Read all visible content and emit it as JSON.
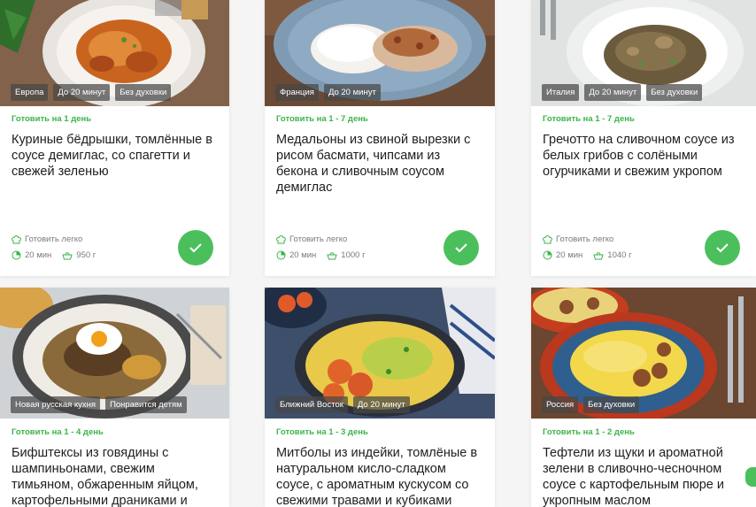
{
  "cards": [
    {
      "tags": [
        "Европа",
        "До 20 минут",
        "Без духовки"
      ],
      "cook_window": "Готовить на 1 день",
      "title": "Куриные бёдрышки, томлённые в соусе демиглас, со спагетти и свежей зеленью",
      "difficulty": "Готовить легко",
      "time": "20 мин",
      "weight": "950 г",
      "selected": true
    },
    {
      "tags": [
        "Франция",
        "До 20 минут"
      ],
      "cook_window": "Готовить на 1 - 7 день",
      "title": "Медальоны из свиной вырезки с рисом басмати, чипсами из бекона и сливочным соусом демиглас",
      "difficulty": "Готовить легко",
      "time": "20 мин",
      "weight": "1000 г",
      "selected": true
    },
    {
      "tags": [
        "Италия",
        "До 20 минут",
        "Без духовки"
      ],
      "cook_window": "Готовить на 1 - 7 день",
      "title": "Гречотто на сливочном соусе из белых грибов с солёными огурчиками и свежим укропом",
      "difficulty": "Готовить легко",
      "time": "20 мин",
      "weight": "1040 г",
      "selected": true
    },
    {
      "tags": [
        "Новая русская кухня",
        "Понравится детям"
      ],
      "cook_window": "Готовить на 1 - 4 день",
      "title": "Бифштексы из говядины с шампиньонами, свежим тимьяном, обжаренным яйцом, картофельными драниками и"
    },
    {
      "tags": [
        "Ближний Восток",
        "До 20 минут"
      ],
      "cook_window": "Готовить на 1 - 3 день",
      "title": "Митболы из индейки, томлёные в натуральном кисло-сладком соусе, с ароматным кускусом со свежими травами и кубиками"
    },
    {
      "tags": [
        "Россия",
        "Без духовки"
      ],
      "cook_window": "Готовить на 1 - 2 день",
      "title": "Тефтели из щуки и ароматной зелени в сливочно-чесночном соусе с картофельным пюре и укропным маслом"
    }
  ],
  "icons": {
    "difficulty": "chef-hat-icon",
    "time": "clock-icon",
    "weight": "bowl-icon",
    "selected": "checkmark-icon"
  },
  "colors": {
    "accent_green": "#4cbf5d",
    "cook_window_green": "#3ab54a",
    "tag_bg": "#464646"
  }
}
